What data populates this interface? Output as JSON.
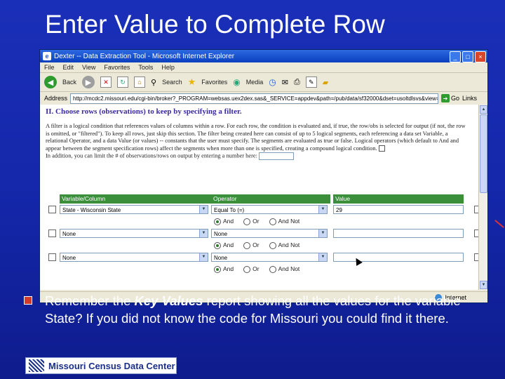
{
  "slide": {
    "title": "Enter Value to Complete Row",
    "bullet_prefix": "Remember the ",
    "bullet_emph": "Key Values",
    "bullet_suffix": " report showing all the values for the variable State?  If you did not know the code for Missouri you could find it there.",
    "logo_text": "Missouri Census Data Center"
  },
  "browser": {
    "window_title": "Dexter -- Data Extraction Tool - Microsoft Internet Explorer",
    "menu": [
      "File",
      "Edit",
      "View",
      "Favorites",
      "Tools",
      "Help"
    ],
    "toolbar": {
      "back": "Back",
      "search": "Search",
      "favorites": "Favorites",
      "media": "Media"
    },
    "address_label": "Address",
    "address": "http://mcdc2.missouri.edu/cgi-bin/broker?_PROGRAM=websas.uex2dex.sas&_SERVICE=appdev&path=/pub/data/sf32000&dset=usoltdlsvs&view=...",
    "go_label": "Go",
    "links_label": "Links",
    "status_zone": "Internet"
  },
  "page": {
    "section_heading": "II.  Choose rows (observations) to keep by specifying a filter.",
    "instructions_1": "A filter is a logical condition that references values of columns within a row. For each row, the condition is evaluated and, if true, the row/obs is selected for output (if not, the row is omitted, or \"filtered\"). To keep all rows, just skip this section. The filter being created here can consist of up to 5 logical segments, each referencing a data set Variable, a relational Operator, and a data Value (or values) -- constants that the user must specify. The segments are evaluated as true or false. Logical operators (which default to And and appear between the segment specification rows) affect the segments when more than one is specified, creating a compound logical condition.",
    "instructions_2": "In addition, you can limit the # of observations/rows on output by entering a number here:",
    "headers": {
      "variable": "Variable/Column",
      "operator": "Operator",
      "value": "Value"
    },
    "rows": [
      {
        "variable": "State - Wisconsin State",
        "operator": "Equal To (=)",
        "value": "29"
      },
      {
        "variable": "None",
        "operator": "None",
        "value": ""
      },
      {
        "variable": "None",
        "operator": "None",
        "value": ""
      }
    ],
    "logic": {
      "and": "And",
      "or": "Or",
      "and_not": "And Not"
    }
  }
}
